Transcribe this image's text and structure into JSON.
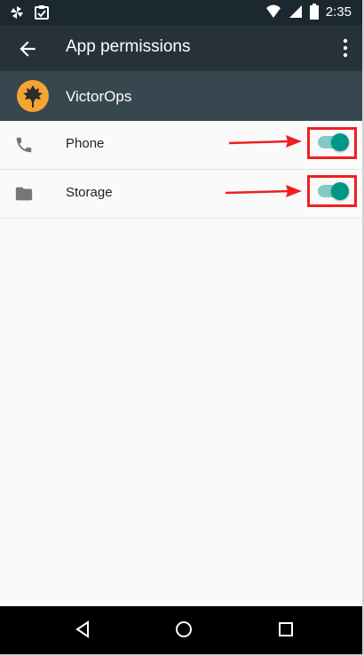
{
  "status_bar": {
    "time": "2:35",
    "icons": [
      "pinwheel-icon",
      "checklist-icon",
      "wifi-icon",
      "signal-icon",
      "battery-icon"
    ]
  },
  "app_bar": {
    "title": "App permissions",
    "back_icon": "arrow-back-icon",
    "overflow_icon": "more-vert-icon"
  },
  "app_header": {
    "app_name": "VictorOps",
    "logo_icon": "victorops-leaf-logo",
    "logo_color": "#f4a431"
  },
  "permissions": [
    {
      "label": "Phone",
      "icon": "phone-icon",
      "enabled": true
    },
    {
      "label": "Storage",
      "icon": "folder-icon",
      "enabled": true
    }
  ],
  "annotations": {
    "highlight_color": "#ef1f1f",
    "description": ""
  },
  "colors": {
    "status_bar": "#1c2830",
    "app_bar": "#263238",
    "app_header": "#37474f",
    "toggle_on_knob": "#009688",
    "toggle_on_track": "#80cbc4"
  },
  "nav_bar": {
    "buttons": [
      "back-triangle-icon",
      "home-circle-icon",
      "recents-square-icon"
    ]
  }
}
